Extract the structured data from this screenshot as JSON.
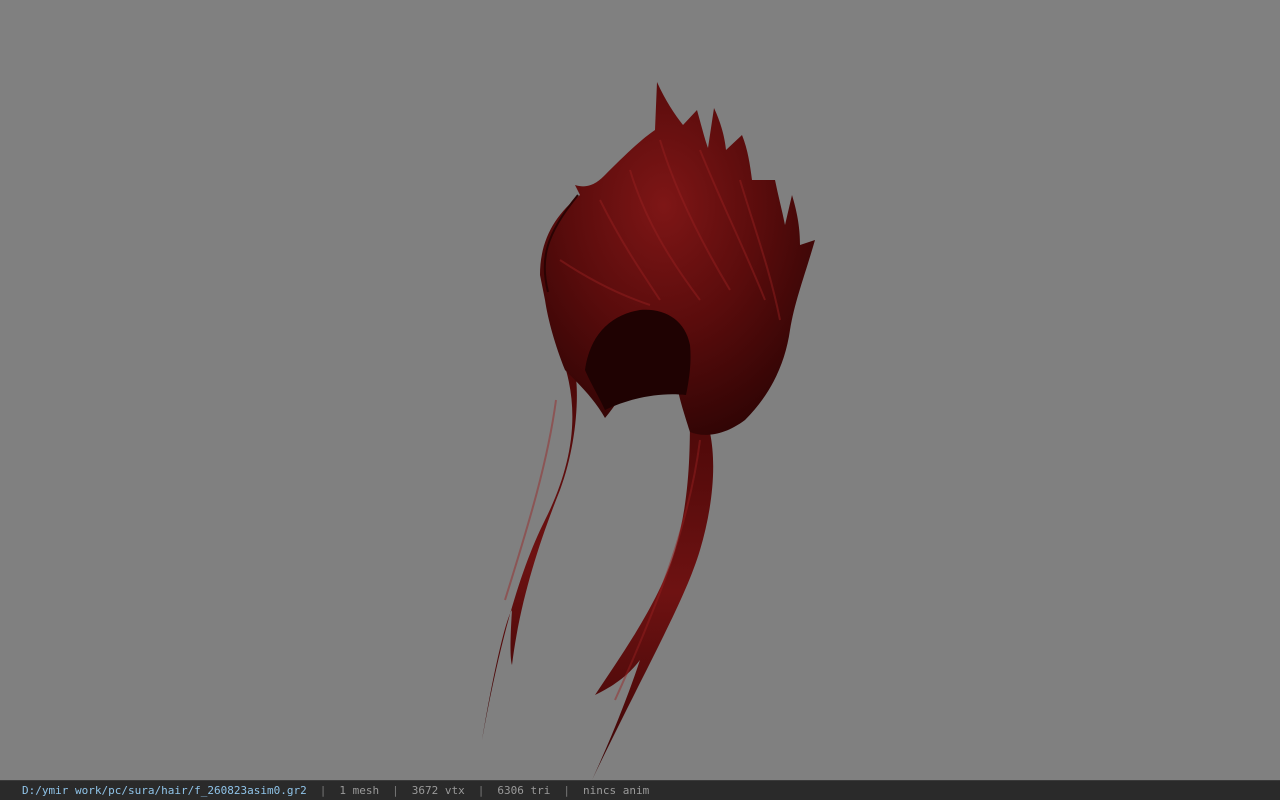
{
  "viewport": {
    "background_color": "#808080",
    "model": {
      "name": "hair-model",
      "base_color": "#3a0606",
      "highlight_color": "#8a1a1a"
    }
  },
  "status_bar": {
    "file_path": "D:/ymir work/pc/sura/hair/f_260823asim0.gr2",
    "separator": "|",
    "mesh_count": "1 mesh",
    "vertex_count": "3672 vtx",
    "triangle_count": "6306 tri",
    "animation": "nincs anim"
  }
}
